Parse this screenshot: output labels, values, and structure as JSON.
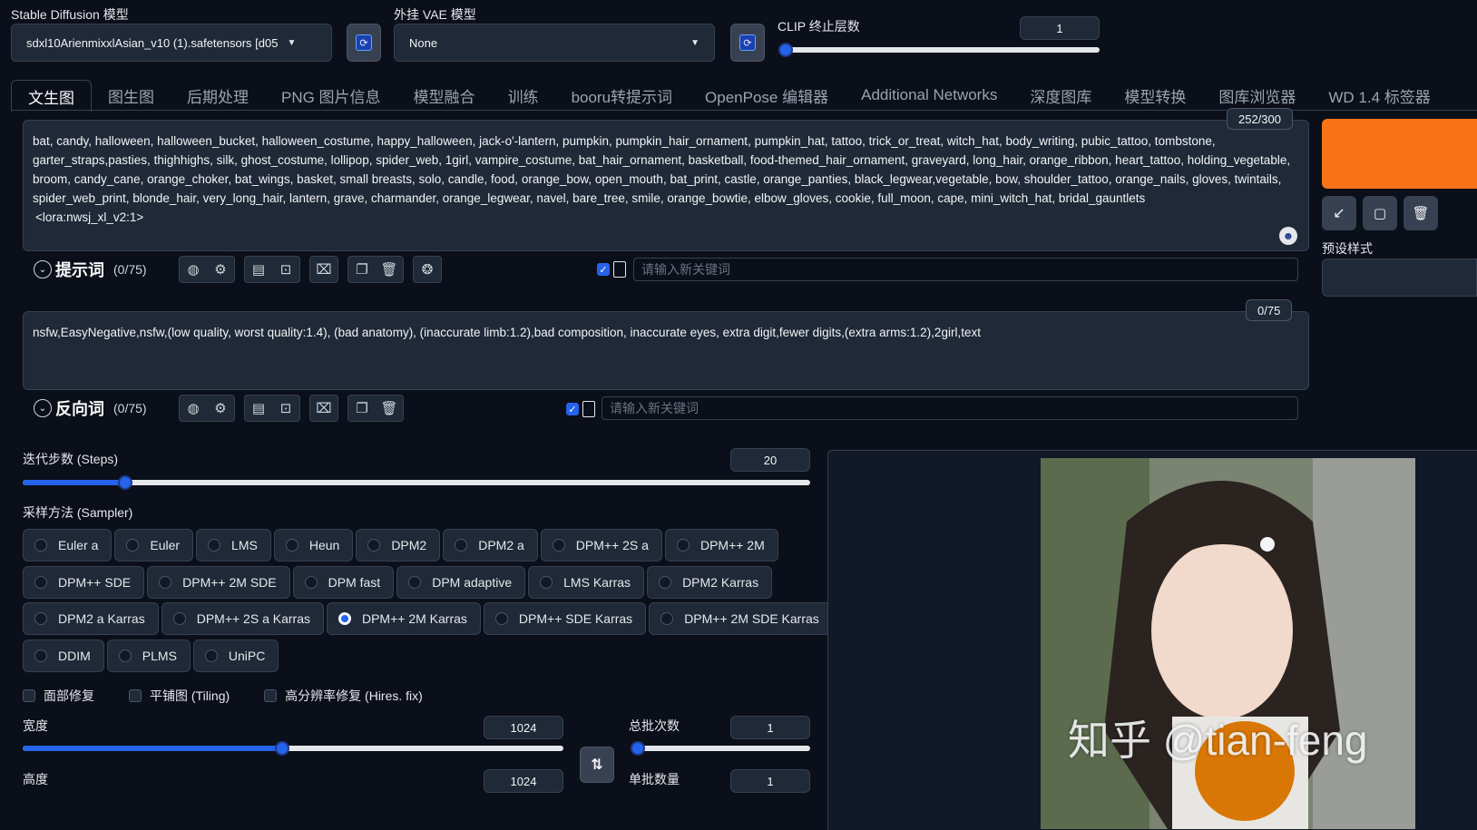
{
  "model": {
    "sd_label": "Stable Diffusion 模型",
    "sd_value": "sdxl10ArienmixxlAsian_v10 (1).safetensors [d05",
    "vae_label": "外挂 VAE 模型",
    "vae_value": "None",
    "clip_label": "CLIP 终止层数",
    "clip_value": "1"
  },
  "tabs": [
    "文生图",
    "图生图",
    "后期处理",
    "PNG 图片信息",
    "模型融合",
    "训练",
    "booru转提示词",
    "OpenPose 编辑器",
    "Additional Networks",
    "深度图库",
    "模型转换",
    "图库浏览器",
    "WD 1.4 标签器"
  ],
  "prompt": {
    "text": "bat, candy, halloween, halloween_bucket, halloween_costume, happy_halloween, jack-o'-lantern, pumpkin, pumpkin_hair_ornament, pumpkin_hat, tattoo, trick_or_treat, witch_hat, body_writing, pubic_tattoo, tombstone, garter_straps,pasties, thighhighs, silk, ghost_costume, lollipop, spider_web, 1girl, vampire_costume, bat_hair_ornament, basketball, food-themed_hair_ornament, graveyard, long_hair, orange_ribbon, heart_tattoo, holding_vegetable, broom, candy_cane, orange_choker, bat_wings, basket, small breasts, solo, candle, food, orange_bow, open_mouth, bat_print, castle, orange_panties, black_legwear,vegetable, bow, shoulder_tattoo, orange_nails, gloves, twintails, spider_web_print, blonde_hair, very_long_hair, lantern, grave, charmander, orange_legwear, navel, bare_tree, smile, orange_bowtie, elbow_gloves, cookie, full_moon, cape, mini_witch_hat, bridal_gauntlets",
    "lora": "<lora:nwsj_xl_v2:1>",
    "counter": "252/300",
    "toggle_label": "提示词",
    "token_count": "(0/75)",
    "keyword_placeholder": "请输入新关键词"
  },
  "negative": {
    "text": "nsfw,EasyNegative,nsfw,(low quality, worst quality:1.4), (bad anatomy), (inaccurate limb:1.2),bad composition, inaccurate eyes, extra digit,fewer digits,(extra arms:1.2),2girl,text",
    "counter": "0/75",
    "toggle_label": "反向词",
    "token_count": "(0/75)",
    "keyword_placeholder": "请输入新关键词"
  },
  "steps": {
    "label": "迭代步数 (Steps)",
    "value": "20",
    "level": 0.13
  },
  "sampler": {
    "label": "采样方法 (Sampler)",
    "rows": [
      [
        "Euler a",
        "Euler",
        "LMS",
        "Heun",
        "DPM2",
        "DPM2 a",
        "DPM++ 2S a",
        "DPM++ 2M"
      ],
      [
        "DPM++ SDE",
        "DPM++ 2M SDE",
        "DPM fast",
        "DPM adaptive",
        "LMS Karras",
        "DPM2 Karras"
      ],
      [
        "DPM2 a Karras",
        "DPM++ 2S a Karras",
        "DPM++ 2M Karras",
        "DPM++ SDE Karras",
        "DPM++ 2M SDE Karras"
      ],
      [
        "DDIM",
        "PLMS",
        "UniPC"
      ]
    ],
    "selected": "DPM++ 2M Karras"
  },
  "options": {
    "face_restore": "面部修复",
    "tiling": "平铺图 (Tiling)",
    "hires": "高分辨率修复 (Hires. fix)"
  },
  "width": {
    "label": "宽度",
    "value": "1024",
    "level": 0.48
  },
  "height": {
    "label": "高度",
    "value": "1024"
  },
  "batch_count": {
    "label": "总批次数",
    "value": "1",
    "level": 0.0
  },
  "batch_size": {
    "label": "单批数量",
    "value": "1"
  },
  "swap_icon": "swap-vertical-icon",
  "right_panel": {
    "styles_label": "预设样式",
    "generate_color": "#f97316"
  },
  "watermark": "知乎 @tian-feng",
  "colors": {
    "accent": "#2563eb",
    "bg": "#0b0f19",
    "panel": "#1f2937"
  }
}
